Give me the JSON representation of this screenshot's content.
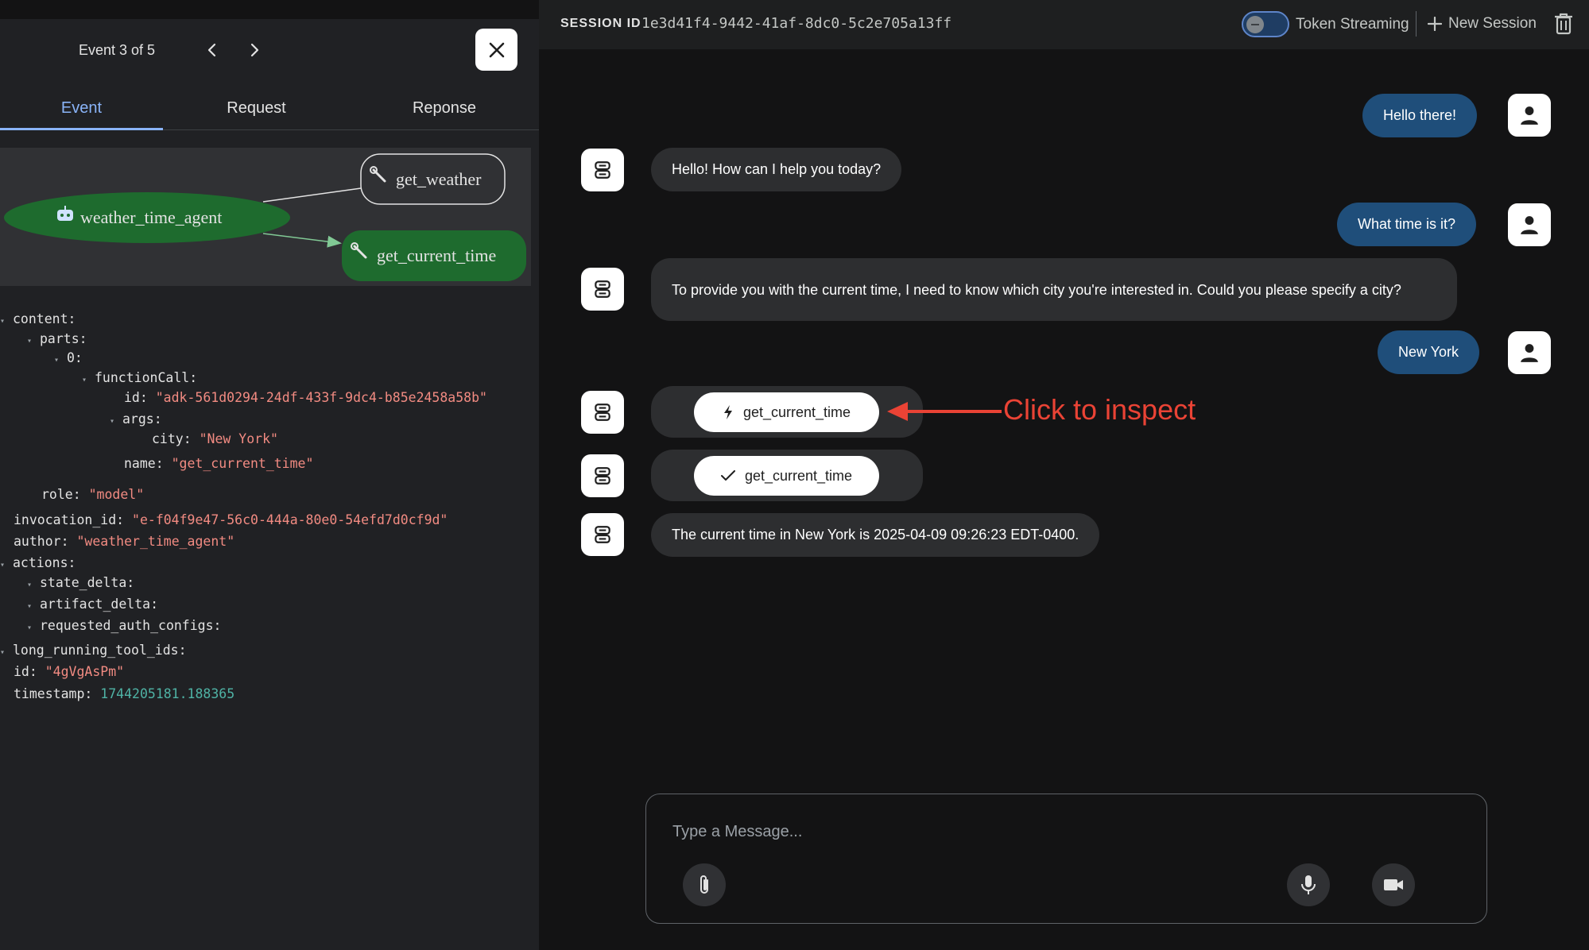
{
  "event_panel": {
    "counter": "Event 3 of 5",
    "tabs": [
      {
        "label": "Event"
      },
      {
        "label": "Request"
      },
      {
        "label": "Reponse"
      }
    ],
    "graph": {
      "agent_node": "weather_time_agent",
      "tool_nodes": [
        "get_weather",
        "get_current_time"
      ]
    },
    "tree": {
      "content_key": "content:",
      "parts_key": "parts:",
      "index_key": "0:",
      "function_call_key": "functionCall:",
      "id_key": "id:",
      "id_val": "\"adk-561d0294-24df-433f-9dc4-b85e2458a58b\"",
      "args_key": "args:",
      "city_key": "city:",
      "city_val": "\"New York\"",
      "name_key": "name:",
      "name_val": "\"get_current_time\"",
      "role_key": "role:",
      "role_val": "\"model\"",
      "invocation_key": "invocation_id:",
      "invocation_val": "\"e-f04f9e47-56c0-444a-80e0-54efd7d0cf9d\"",
      "author_key": "author:",
      "author_val": "\"weather_time_agent\"",
      "actions_key": "actions:",
      "state_delta_key": "state_delta:",
      "artifact_delta_key": "artifact_delta:",
      "auth_configs_key": "requested_auth_configs:",
      "long_running_key": "long_running_tool_ids:",
      "event_id_key": "id:",
      "event_id_val": "\"4gVgAsPm\"",
      "timestamp_key": "timestamp:",
      "timestamp_val": "1744205181.188365"
    }
  },
  "header": {
    "session_label": "SESSION ID",
    "session_id": "1e3d41f4-9442-41af-8dc0-5c2e705a13ff",
    "token_streaming_label": "Token Streaming",
    "token_streaming_on": false,
    "new_session_label": "New Session"
  },
  "chat": {
    "messages": [
      {
        "role": "user",
        "text": "Hello there!"
      },
      {
        "role": "bot",
        "text": "Hello! How can I help you today?"
      },
      {
        "role": "user",
        "text": "What time is it?"
      },
      {
        "role": "bot",
        "text": "To provide you with the current time, I need to know which city you're interested in. Could you please specify a city?"
      },
      {
        "role": "user",
        "text": "New York"
      },
      {
        "role": "bot",
        "tool_call": "get_current_time",
        "icon": "bolt-icon"
      },
      {
        "role": "bot",
        "tool_response": "get_current_time",
        "icon": "check-icon"
      },
      {
        "role": "bot",
        "text": "The current time in New York is 2025-04-09 09:26:23 EDT-0400."
      }
    ],
    "annotation": "Click to inspect"
  },
  "composer": {
    "placeholder": "Type a Message..."
  },
  "colors": {
    "accent": "#8ab4f8",
    "user_bubble": "#1f4e7a",
    "bot_bubble": "#2d2e30",
    "graph_agent_node": "#1e6b2e",
    "annotation": "#ea4335",
    "json_string": "#f28b82",
    "json_number": "#4fb3a5"
  }
}
